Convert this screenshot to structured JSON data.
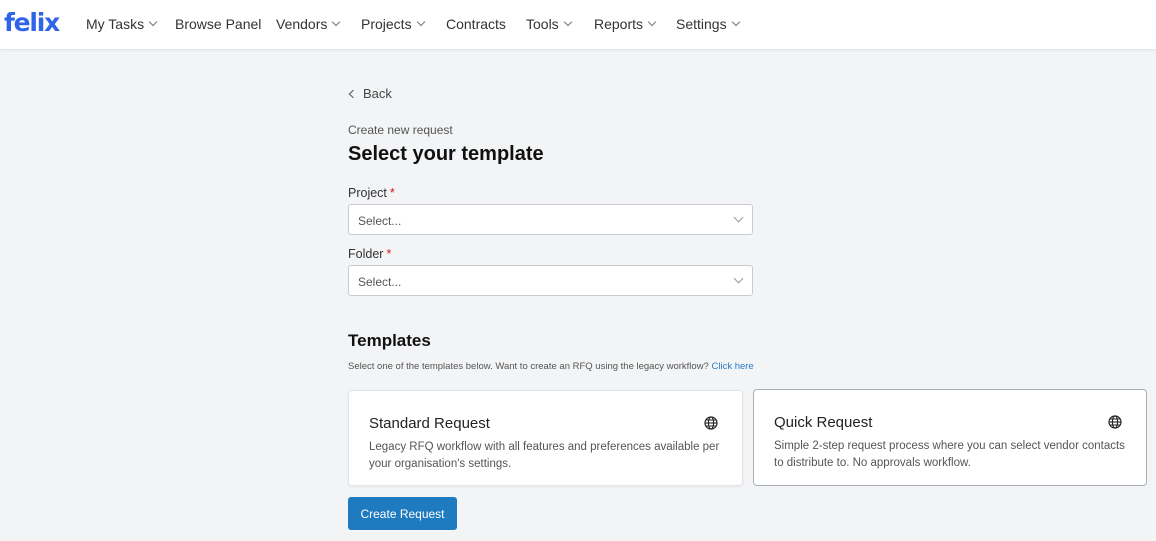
{
  "brand": {
    "logo_text": "felix",
    "color": "#2f63e8"
  },
  "nav": {
    "items": [
      {
        "label": "My Tasks",
        "has_dropdown": true
      },
      {
        "label": "Browse Panel",
        "has_dropdown": false
      },
      {
        "label": "Vendors",
        "has_dropdown": true
      },
      {
        "label": "Projects",
        "has_dropdown": true
      },
      {
        "label": "Contracts",
        "has_dropdown": false
      },
      {
        "label": "Tools",
        "has_dropdown": true
      },
      {
        "label": "Reports",
        "has_dropdown": true
      },
      {
        "label": "Settings",
        "has_dropdown": true
      }
    ]
  },
  "page": {
    "back_label": "Back",
    "subtitle": "Create new request",
    "title": "Select your template"
  },
  "form": {
    "project": {
      "label": "Project",
      "required_mark": "*",
      "value": "Select..."
    },
    "folder": {
      "label": "Folder",
      "required_mark": "*",
      "value": "Select..."
    }
  },
  "templates": {
    "heading": "Templates",
    "help_text": "Select one of the templates below. Want to create an RFQ using the legacy workflow?",
    "help_link": "Click here",
    "link_color": "#2a7cc7",
    "cards": [
      {
        "title": "Standard Request",
        "description": "Legacy RFQ workflow with all features and preferences available per your organisation's settings.",
        "icon": "globe-icon",
        "selected": false
      },
      {
        "title": "Quick Request",
        "description": "Simple 2-step request process where you can select vendor contacts to distribute to. No approvals workflow.",
        "icon": "globe-icon",
        "selected": true
      }
    ]
  },
  "actions": {
    "create_label": "Create Request",
    "create_color": "#1f7bbf"
  }
}
